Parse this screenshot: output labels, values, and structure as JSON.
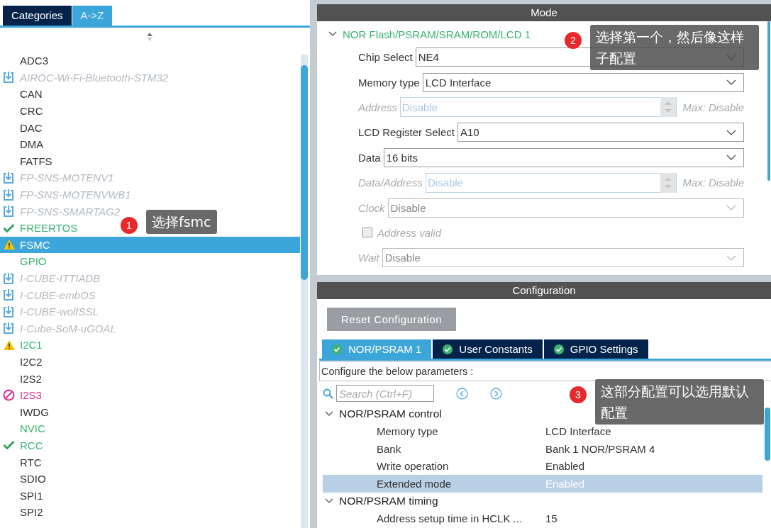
{
  "left_panel": {
    "tabs": [
      {
        "label": "Categories",
        "selected": false
      },
      {
        "label": "A->Z",
        "selected": true
      }
    ],
    "items": [
      {
        "label": "ADC3",
        "kind": "plain",
        "selected": false
      },
      {
        "label": "AIROC-Wi-Fi-Bluetooth-STM32",
        "kind": "package",
        "selected": false
      },
      {
        "label": "CAN",
        "kind": "plain",
        "selected": false
      },
      {
        "label": "CRC",
        "kind": "plain",
        "selected": false
      },
      {
        "label": "DAC",
        "kind": "plain",
        "selected": false
      },
      {
        "label": "DMA",
        "kind": "plain",
        "selected": false
      },
      {
        "label": "FATFS",
        "kind": "plain",
        "selected": false
      },
      {
        "label": "FP-SNS-MOTENV1",
        "kind": "package",
        "selected": false
      },
      {
        "label": "FP-SNS-MOTENVWB1",
        "kind": "package",
        "selected": false
      },
      {
        "label": "FP-SNS-SMARTAG2",
        "kind": "package",
        "selected": false
      },
      {
        "label": "FREERTOS",
        "kind": "ok",
        "selected": false
      },
      {
        "label": "FSMC",
        "kind": "warning",
        "selected": true
      },
      {
        "label": "GPIO",
        "kind": "active",
        "selected": false
      },
      {
        "label": "I-CUBE-ITTIADB",
        "kind": "package",
        "selected": false
      },
      {
        "label": "I-CUBE-embOS",
        "kind": "package",
        "selected": false
      },
      {
        "label": "I-CUBE-wolfSSL",
        "kind": "package",
        "selected": false
      },
      {
        "label": "I-Cube-SoM-uGOAL",
        "kind": "package",
        "selected": false
      },
      {
        "label": "I2C1",
        "kind": "partial",
        "selected": false
      },
      {
        "label": "I2C2",
        "kind": "plain",
        "selected": false
      },
      {
        "label": "I2S2",
        "kind": "plain",
        "selected": false
      },
      {
        "label": "I2S3",
        "kind": "conflict",
        "selected": false
      },
      {
        "label": "IWDG",
        "kind": "plain",
        "selected": false
      },
      {
        "label": "NVIC",
        "kind": "active",
        "selected": false
      },
      {
        "label": "RCC",
        "kind": "ok",
        "selected": false
      },
      {
        "label": "RTC",
        "kind": "plain",
        "selected": false
      },
      {
        "label": "SDIO",
        "kind": "plain",
        "selected": false
      },
      {
        "label": "SPI1",
        "kind": "plain",
        "selected": false
      },
      {
        "label": "SPI2",
        "kind": "plain",
        "selected": false
      }
    ]
  },
  "mode": {
    "title": "Mode",
    "group": {
      "label": "NOR Flash/PSRAM/SRAM/ROM/LCD 1",
      "expanded": true
    },
    "fields": [
      {
        "kind": "select",
        "label": "Chip Select",
        "value": "NE4",
        "disabled": false
      },
      {
        "kind": "select",
        "label": "Memory type",
        "value": "LCD Interface",
        "disabled": false
      },
      {
        "kind": "spinner",
        "label": "Address",
        "value": "Disable",
        "note": "Max: Disable",
        "disabled": true
      },
      {
        "kind": "select",
        "label": "LCD Register Select",
        "value": "A10",
        "disabled": false
      },
      {
        "kind": "select",
        "label": "Data",
        "value": "16 bits",
        "disabled": false
      },
      {
        "kind": "spinner",
        "label": "Data/Address",
        "value": "Disable",
        "note": "Max: Disable",
        "disabled": true
      },
      {
        "kind": "select",
        "label": "Clock",
        "value": "Disable",
        "disabled": true
      },
      {
        "kind": "checkbox",
        "label": "Address valid",
        "checked": false,
        "disabled": true
      },
      {
        "kind": "select",
        "label": "Wait",
        "value": "Disable",
        "disabled": true
      }
    ]
  },
  "configuration": {
    "title": "Configuration",
    "reset_button": "Reset Configuration",
    "tabs": [
      {
        "label": "NOR/PSRAM 1",
        "selected": true
      },
      {
        "label": "User Constants",
        "selected": false
      },
      {
        "label": "GPIO Settings",
        "selected": false
      }
    ],
    "hint": "Configure the below parameters :",
    "search": {
      "placeholder": "Search (Ctrl+F)"
    },
    "groups": [
      {
        "label": "NOR/PSRAM control",
        "expanded": true,
        "rows": [
          {
            "name": "Memory type",
            "value": "LCD Interface",
            "selected": false
          },
          {
            "name": "Bank",
            "value": "Bank 1 NOR/PSRAM 4",
            "selected": false
          },
          {
            "name": "Write operation",
            "value": "Enabled",
            "selected": false
          },
          {
            "name": "Extended mode",
            "value": "Enabled",
            "selected": true
          }
        ]
      },
      {
        "label": "NOR/PSRAM timing",
        "expanded": true,
        "rows": [
          {
            "name": "Address setup time in HCLK ...",
            "value": "15",
            "selected": false
          }
        ]
      }
    ]
  },
  "callouts": [
    {
      "number": "1",
      "text": "选择fsmc"
    },
    {
      "number": "2",
      "text": "选择第一个，然后像这样子配置"
    },
    {
      "number": "3",
      "text": "这部分配置可以选用默认配置"
    }
  ]
}
